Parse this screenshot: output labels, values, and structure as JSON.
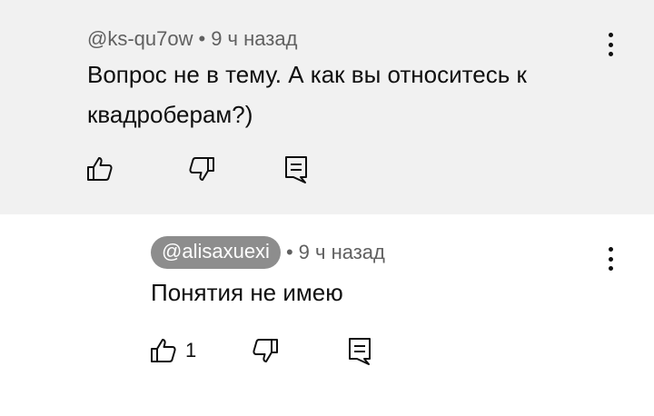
{
  "comments": [
    {
      "author": "@ks-qu7ow",
      "separator": "•",
      "time": "9 ч назад",
      "text": "Вопрос не в тему. А как вы относитесь к квадроберам?)",
      "like_count": "",
      "icons": {
        "like": "thumb-up-icon",
        "dislike": "thumb-down-icon",
        "reply": "reply-comment-icon",
        "more": "more-vert-icon"
      }
    },
    {
      "author": "@alisaxuexi",
      "separator": "•",
      "time": "9 ч назад",
      "text": "Понятия не имею",
      "like_count": "1",
      "author_highlighted": true,
      "icons": {
        "like": "thumb-up-icon",
        "dislike": "thumb-down-icon",
        "reply": "reply-comment-icon",
        "more": "more-vert-icon"
      }
    }
  ],
  "colors": {
    "parent_background": "#f1f1f1",
    "author_chip": "#8d8d8d",
    "meta_text": "#606060",
    "text": "#0f0f0f"
  }
}
